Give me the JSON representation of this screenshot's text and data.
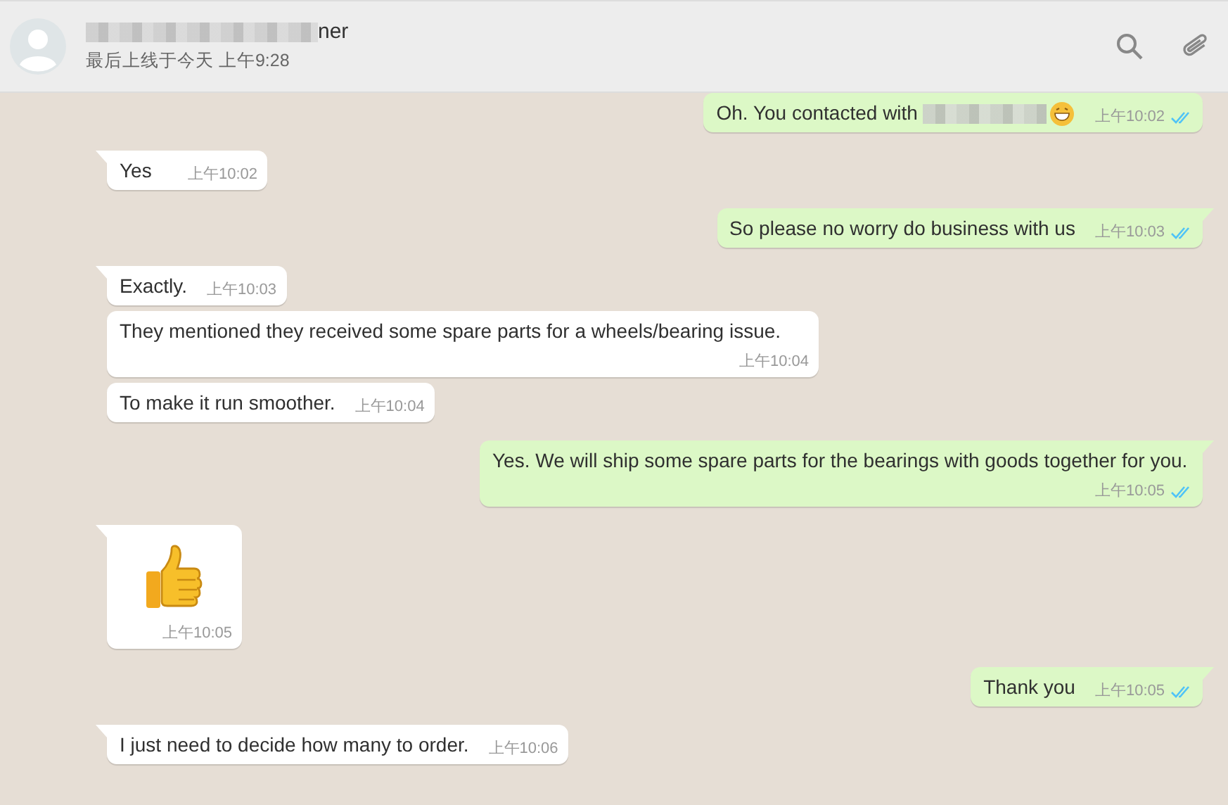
{
  "header": {
    "name": {
      "text": "ner",
      "redacted": true
    },
    "status": "最后上线于今天 上午9:28"
  },
  "messages": [
    {
      "kind": "text",
      "sent": true,
      "tail": false,
      "text": "Oh. You contacted with",
      "redacted": true,
      "grin_emoji": true,
      "time": "上午10:02",
      "read": true
    },
    {
      "kind": "text",
      "sent": false,
      "tail": true,
      "text": "Yes",
      "time": "上午10:02"
    },
    {
      "kind": "text",
      "sent": true,
      "tail": true,
      "text": "So please no worry do business with us",
      "time": "上午10:03",
      "read": true
    },
    {
      "kind": "text",
      "sent": false,
      "tail": true,
      "text": "Exactly.",
      "time": "上午10:03"
    },
    {
      "kind": "text",
      "sent": false,
      "tail": false,
      "text": "They mentioned they received some spare parts for a wheels/bearing issue.",
      "time": "上午10:04"
    },
    {
      "kind": "text",
      "sent": false,
      "tail": false,
      "text": "To make it run smoother.",
      "time": "上午10:04"
    },
    {
      "kind": "text",
      "sent": true,
      "tail": true,
      "text": "Yes. We will ship some spare parts for the bearings with goods together for you.",
      "time": "上午10:05",
      "read": true
    },
    {
      "kind": "thumbs",
      "sent": false,
      "tail": true,
      "time": "上午10:05"
    },
    {
      "kind": "text",
      "sent": true,
      "tail": true,
      "text": "Thank you",
      "time": "上午10:05",
      "read": true
    },
    {
      "kind": "text",
      "sent": false,
      "tail": true,
      "text": "I just need to decide how many to order.",
      "time": "上午10:06"
    }
  ]
}
